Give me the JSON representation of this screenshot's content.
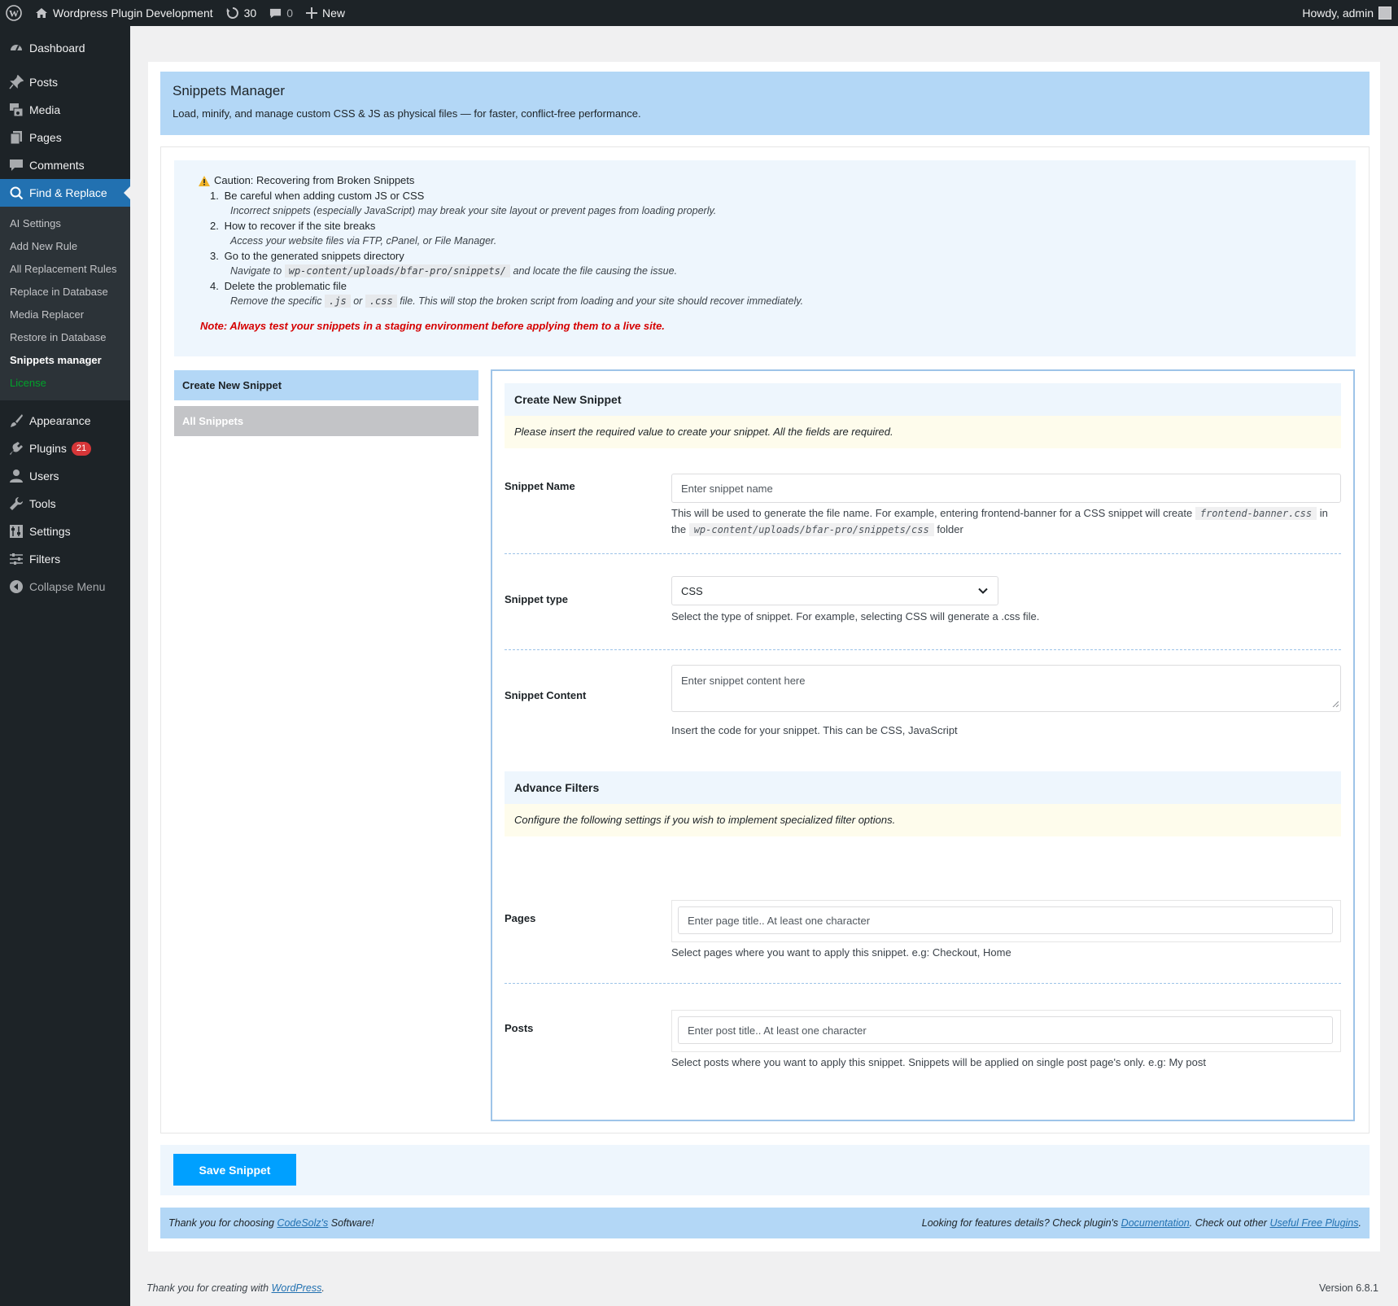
{
  "adminbar": {
    "site_name": "Wordpress Plugin Development",
    "updates_count": "30",
    "comments_count": "0",
    "new_label": "New",
    "howdy": "Howdy, admin"
  },
  "sidebar": {
    "dashboard": "Dashboard",
    "posts": "Posts",
    "media": "Media",
    "pages": "Pages",
    "comments": "Comments",
    "find_replace": "Find & Replace",
    "submenu": [
      "AI Settings",
      "Add New Rule",
      "All Replacement Rules",
      "Replace in Database",
      "Media Replacer",
      "Restore in Database",
      "Snippets manager",
      "License"
    ],
    "appearance": "Appearance",
    "plugins": "Plugins",
    "plugins_badge": "21",
    "users": "Users",
    "tools": "Tools",
    "settings": "Settings",
    "filters": "Filters",
    "collapse": "Collapse Menu"
  },
  "header": {
    "title": "Snippets Manager",
    "subtitle": "Load, minify, and manage custom CSS & JS as physical files — for faster, conflict-free performance."
  },
  "caution": {
    "title": "Caution: Recovering from Broken Snippets",
    "items": [
      {
        "num": "1.",
        "title": "Be careful when adding custom JS or CSS",
        "detail": "Incorrect snippets (especially JavaScript) may break your site layout or prevent pages from loading properly."
      },
      {
        "num": "2.",
        "title": "How to recover if the site breaks",
        "detail": "Access your website files via FTP, cPanel, or File Manager."
      },
      {
        "num": "3.",
        "title": "Go to the generated snippets directory",
        "detail_pre": "Navigate to",
        "detail_code": "wp-content/uploads/bfar-pro/snippets/",
        "detail_post": "and locate the file causing the issue."
      },
      {
        "num": "4.",
        "title": "Delete the problematic file",
        "detail_pre": "Remove the specific",
        "code_js": ".js",
        "or": "or",
        "code_css": ".css",
        "detail_post": "file. This will stop the broken script from loading and your site should recover immediately."
      }
    ],
    "note": "Note: Always test your snippets in a staging environment before applying them to a live site."
  },
  "tabs": {
    "create": "Create New Snippet",
    "all": "All Snippets"
  },
  "form": {
    "section_title": "Create New Snippet",
    "section_note": "Please insert the required value to create your snippet. All the fields are required.",
    "name_label": "Snippet Name",
    "name_placeholder": "Enter snippet name",
    "name_desc_1": "This will be used to generate the file name. For example, entering frontend-banner for a CSS snippet will create",
    "name_desc_code1": "frontend-banner.css",
    "name_desc_2": "in the",
    "name_desc_code2": "wp-content/uploads/bfar-pro/snippets/css",
    "name_desc_3": "folder",
    "type_label": "Snippet type",
    "type_value": "CSS",
    "type_desc": "Select the type of snippet. For example, selecting CSS will generate a .css file.",
    "content_label": "Snippet Content",
    "content_placeholder": "Enter snippet content here",
    "content_desc": "Insert the code for your snippet. This can be CSS, JavaScript",
    "adv_title": "Advance Filters",
    "adv_note": "Configure the following settings if you wish to implement specialized filter options.",
    "pages_label": "Pages",
    "pages_placeholder": "Enter page title.. At least one character",
    "pages_desc": "Select pages where you want to apply this snippet. e.g: Checkout, Home",
    "posts_label": "Posts",
    "posts_placeholder": "Enter post title.. At least one character",
    "posts_desc": "Select posts where you want to apply this snippet. Snippets will be applied on single post page's only. e.g: My post"
  },
  "save_label": "Save Snippet",
  "plugin_footer": {
    "left_pre": "Thank you for choosing",
    "left_link": "CodeSolz's",
    "left_post": "Software!",
    "right_pre": "Looking for features details? Check plugin's",
    "right_link1": "Documentation",
    "right_mid": ". Check out other",
    "right_link2": "Useful Free Plugins",
    "right_end": "."
  },
  "wp_footer": {
    "left_pre": "Thank you for creating with",
    "left_link": "WordPress",
    "left_end": ".",
    "version": "Version 6.8.1"
  },
  "colors": {
    "accent": "#2271b1",
    "header_bg": "#b3d7f6",
    "save_button": "#00a0ff",
    "note_red": "#d50000",
    "license_green": "#00a32a"
  }
}
